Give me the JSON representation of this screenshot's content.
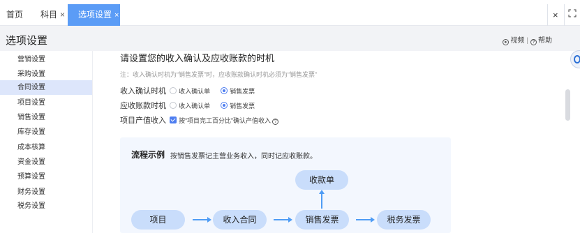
{
  "tabs": {
    "home": "首页",
    "kemu": "科目",
    "active": "选项设置",
    "close_x": "×"
  },
  "window": {
    "close": "×",
    "fullscreen": "fullscreen-icon"
  },
  "page": {
    "title": "选项设置",
    "video": "视频",
    "help": "帮助"
  },
  "sidebar": {
    "items": [
      {
        "label": "营销设置"
      },
      {
        "label": "采购设置"
      },
      {
        "label": "合同设置",
        "active": true
      },
      {
        "label": "项目设置"
      },
      {
        "label": "销售设置"
      },
      {
        "label": "库存设置"
      },
      {
        "label": "成本核算"
      },
      {
        "label": "资金设置"
      },
      {
        "label": "预算设置"
      },
      {
        "label": "财务设置"
      },
      {
        "label": "税务设置"
      }
    ]
  },
  "main": {
    "question": "请设置您的收入确认及应收账款的时机",
    "note": "注：收入确认时机为“销售发票”时，应收账款确认时机必须为“销售发票”",
    "rows": [
      {
        "label": "收入确认时机",
        "opt1": "收入确认单",
        "opt2": "销售发票",
        "selected": "销售发票"
      },
      {
        "label": "应收账款时机",
        "opt1": "收入确认单",
        "opt2": "销售发票",
        "selected": "销售发票"
      }
    ],
    "project": {
      "label": "项目产值收入",
      "checkbox_label": "按“项目完工百分比”确认产值收入",
      "checked": true
    }
  },
  "flow": {
    "title": "流程示例",
    "desc": "按销售发票记主营业务收入，同时记应收账款。",
    "nodes": {
      "project": "项目",
      "contract": "收入合同",
      "invoice": "销售发票",
      "receipt": "收款单",
      "tax": "税务发票"
    }
  },
  "colors": {
    "accent": "#5b9cf6",
    "node_bg": "#c9ddfb",
    "arrow": "#4e9cf5",
    "active_sidebar": "#dde6fb"
  }
}
